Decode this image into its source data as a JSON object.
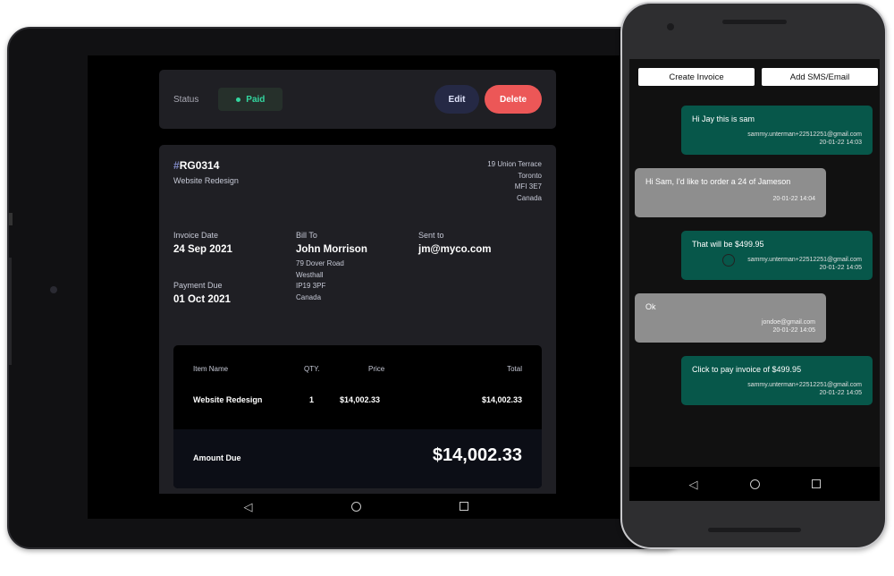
{
  "invoice": {
    "status_label": "Status",
    "status_value": "Paid",
    "edit_label": "Edit",
    "delete_label": "Delete",
    "id_hash": "#",
    "id": "RG0314",
    "description": "Website Redesign",
    "sender_address": [
      "19 Union Terrace",
      "Toronto",
      "MFI 3E7",
      "Canada"
    ],
    "invoice_date_label": "Invoice Date",
    "invoice_date": "24 Sep 2021",
    "payment_due_label": "Payment Due",
    "payment_due": "01 Oct 2021",
    "bill_to_label": "Bill To",
    "bill_to_name": "John Morrison",
    "bill_to_address": [
      "79 Dover Road",
      "Westhall",
      "IP19 3PF",
      "Canada"
    ],
    "sent_to_label": "Sent to",
    "sent_to": "jm@myco.com",
    "items_headers": {
      "name": "Item Name",
      "qty": "QTY.",
      "price": "Price",
      "total": "Total"
    },
    "items": [
      {
        "name": "Website Redesign",
        "qty": "1",
        "price": "$14,002.33",
        "total": "$14,002.33"
      }
    ],
    "amount_due_label": "Amount Due",
    "amount_due": "$14,002.33"
  },
  "chat": {
    "create_invoice_label": "Create Invoice",
    "add_sms_label": "Add SMS/Email",
    "messages": [
      {
        "direction": "out",
        "text": "Hi Jay this is sam",
        "sender": "sammy.unterman+22512251@gmail.com",
        "time": "20-01-22 14:03"
      },
      {
        "direction": "in",
        "text": "Hi Sam, I'd like to order a 24 of Jameson",
        "sender": "",
        "time": "20-01-22 14:04"
      },
      {
        "direction": "out",
        "text": "That will be $499.95",
        "sender": "sammy.unterman+22512251@gmail.com",
        "time": "20-01-22 14:05"
      },
      {
        "direction": "in",
        "text": "Ok",
        "sender": "jondoe@gmail.com",
        "time": "20-01-22 14:05"
      },
      {
        "direction": "out",
        "text": "Click to pay invoice of $499.95",
        "sender": "sammy.unterman+22512251@gmail.com",
        "time": "20-01-22 14:05"
      }
    ]
  },
  "icons": {
    "back": "back-triangle-icon",
    "home": "home-circle-icon",
    "recents": "recents-square-icon"
  },
  "colors": {
    "paid": "#33d69f",
    "delete": "#ec5757",
    "edit": "#252945",
    "outgoing_bubble": "#07574a",
    "incoming_bubble": "#8e8e8e"
  }
}
